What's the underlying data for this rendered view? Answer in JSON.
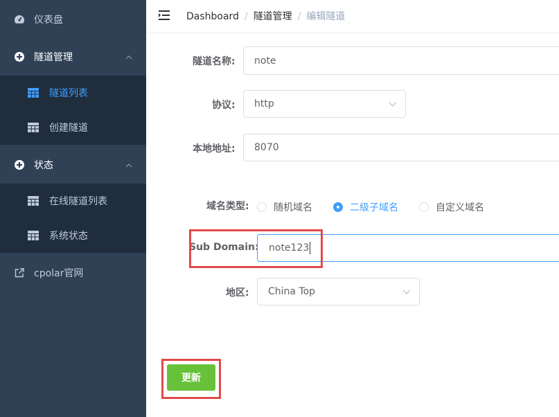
{
  "sidebar": {
    "items": [
      {
        "label": "仪表盘",
        "icon": "dashboard-icon"
      },
      {
        "label": "隧道管理",
        "icon": "plus-circle-icon",
        "expanded": true,
        "children": [
          {
            "label": "隧道列表",
            "icon": "table-icon",
            "active": true
          },
          {
            "label": "创建隧道",
            "icon": "table-icon"
          }
        ]
      },
      {
        "label": "状态",
        "icon": "plus-circle-icon",
        "expanded": true,
        "children": [
          {
            "label": "在线隧道列表",
            "icon": "table-icon"
          },
          {
            "label": "系统状态",
            "icon": "table-icon"
          }
        ]
      },
      {
        "label": "cpolar官网",
        "icon": "external-link-icon"
      }
    ]
  },
  "header": {
    "breadcrumb": [
      "Dashboard",
      "隧道管理",
      "编辑隧道"
    ],
    "separator": "/"
  },
  "form": {
    "name": {
      "label": "隧道名称:",
      "value": "note"
    },
    "protocol": {
      "label": "协议:",
      "value": "http"
    },
    "local_addr": {
      "label": "本地地址:",
      "value": "8070"
    },
    "domain_type": {
      "label": "域名类型:",
      "options": [
        "随机域名",
        "二级子域名",
        "自定义域名"
      ],
      "selected": "二级子域名"
    },
    "sub_domain": {
      "label": "Sub Domain:",
      "value": "note123"
    },
    "region": {
      "label": "地区:",
      "value": "China Top"
    },
    "submit_label": "更新"
  },
  "colors": {
    "sidebar_bg": "#304156",
    "submenu_bg": "#1f2d3d",
    "accent": "#409eff",
    "button": "#67c23a",
    "highlight": "#e04a4a"
  }
}
